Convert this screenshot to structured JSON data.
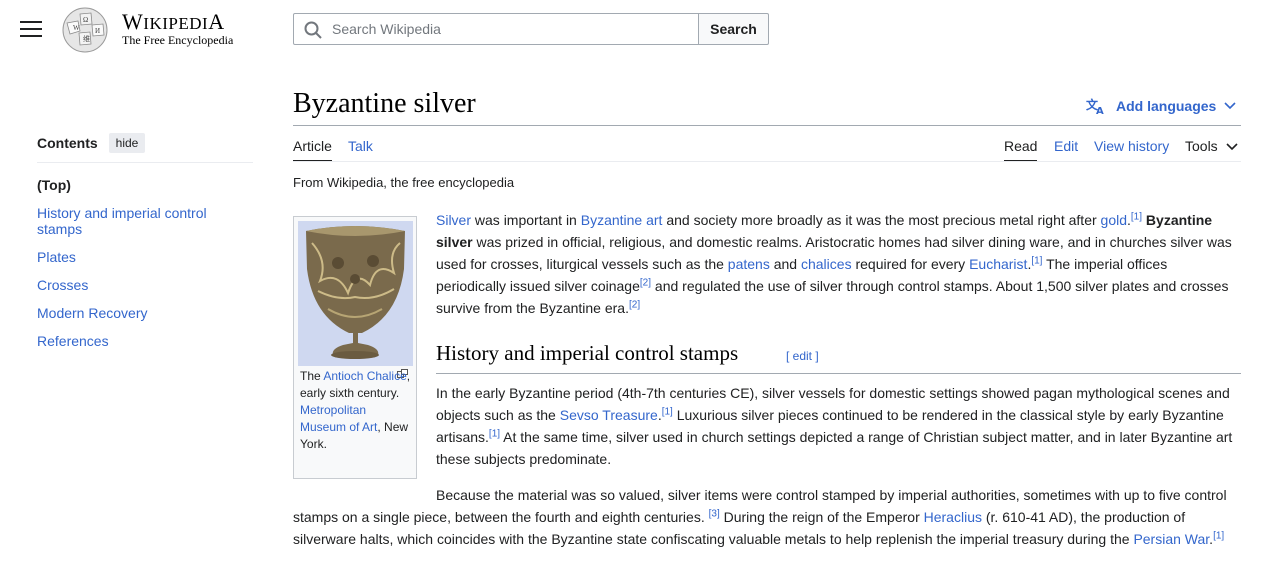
{
  "header": {
    "logo_word": "Wikipedia",
    "logo_tagline": "The Free Encyclopedia",
    "search_placeholder": "Search Wikipedia",
    "search_button": "Search"
  },
  "toc": {
    "title": "Contents",
    "hide_label": "hide",
    "top_label": "(Top)",
    "items": [
      "History and imperial control stamps",
      "Plates",
      "Crosses",
      "Modern Recovery",
      "References"
    ]
  },
  "page": {
    "title": "Byzantine silver",
    "add_languages": "Add languages",
    "tabs_left": [
      "Article",
      "Talk"
    ],
    "tabs_right": [
      "Read",
      "Edit",
      "View history",
      "Tools"
    ],
    "from_wiki": "From Wikipedia, the free encyclopedia"
  },
  "thumb": {
    "caption_pre": "The ",
    "caption_link1": "Antioch Chalice",
    "caption_mid": ", early sixth century. ",
    "caption_link2": "Metropolitan Museum of Art",
    "caption_post": ", New York."
  },
  "intro": {
    "l_silver": "Silver",
    "t1": " was important in ",
    "l_art": "Byzantine art",
    "t2": " and society more broadly as it was the most precious metal right after ",
    "l_gold": "gold",
    "t3": ".",
    "ref1": "[1]",
    "b_bold": "Byzantine silver",
    "t4": " was prized in official, religious, and domestic realms. Aristocratic homes had silver dining ware, and in churches silver was used for crosses, liturgical vessels such as the ",
    "l_patens": "patens",
    "t5": " and ",
    "l_chalices": "chalices",
    "t6": " required for every ",
    "l_eucharist": "Eucharist",
    "t7": ".",
    "ref2": "[1]",
    "t8": " The imperial offices periodically issued silver coinage",
    "ref3": "[2]",
    "t9": " and regulated the use of silver through control stamps. About 1,500 silver plates and crosses survive from the Byzantine era.",
    "ref4": "[2]"
  },
  "section": {
    "heading": "History and imperial control stamps",
    "edit_label": "[ edit ]",
    "p1_a": "In the early Byzantine period (4th-7th centuries CE), silver vessels for domestic settings showed pagan mythological scenes and objects such as the ",
    "p1_link": "Sevso Treasure",
    "p1_b": ".",
    "p1_ref1": "[1]",
    "p1_c": " Luxurious silver pieces continued to be rendered in the classical style by early Byzantine artisans.",
    "p1_ref2": "[1]",
    "p1_d": " At the same time, silver used in church settings depicted a range of Christian subject matter, and in later Byzantine art these subjects predominate.",
    "p2_a": "Because the material was so valued, silver items were control stamped by imperial authorities, sometimes with up to five control stamps on a single piece, between the fourth and eighth centuries. ",
    "p2_ref1": "[3]",
    "p2_b": " During the reign of the Emperor ",
    "p2_link1": "Heraclius",
    "p2_c": " (r. 610-41 AD), the production of silverware halts, which coincides with the Byzantine state confiscating valuable metals to help replenish the imperial treasury during the ",
    "p2_link2": "Persian War",
    "p2_d": ".",
    "p2_ref2": "[1]"
  }
}
